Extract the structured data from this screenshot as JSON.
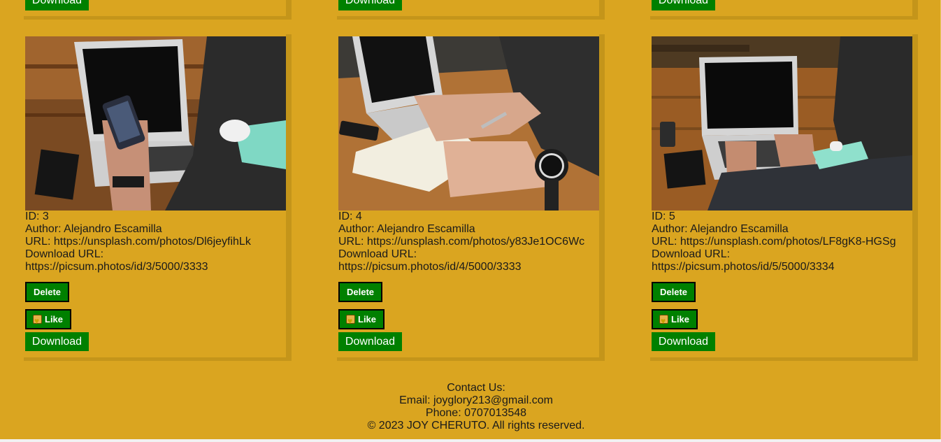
{
  "top_row": {
    "download_labels": [
      "Download",
      "Download",
      "Download"
    ]
  },
  "cards": [
    {
      "id": "ID: 3",
      "author": "Author: Alejandro Escamilla",
      "url": "URL: https://unsplash.com/photos/Dl6jeyfihLk",
      "download_url_label": "Download URL:",
      "download_url": "https://picsum.photos/id/3/5000/3333",
      "delete_label": "Delete",
      "like_label": "Like",
      "download_label": "Download",
      "image_icon": "photo-laptop-phone"
    },
    {
      "id": "ID: 4",
      "author": "Author: Alejandro Escamilla",
      "url": "URL: https://unsplash.com/photos/y83Je1OC6Wc",
      "download_url_label": "Download URL:",
      "download_url": "https://picsum.photos/id/4/5000/3333",
      "delete_label": "Delete",
      "like_label": "Like",
      "download_label": "Download",
      "image_icon": "photo-notebook-watch"
    },
    {
      "id": "ID: 5",
      "author": "Author: Alejandro Escamilla",
      "url": "URL: https://unsplash.com/photos/LF8gK8-HGSg",
      "download_url_label": "Download URL:",
      "download_url": "https://picsum.photos/id/5/5000/3334",
      "delete_label": "Delete",
      "like_label": "Like",
      "download_label": "Download",
      "image_icon": "photo-laptop-typing"
    }
  ],
  "footer": {
    "contact_heading": "Contact Us:",
    "email": "Email: joyglory213@gmail.com",
    "phone": "Phone: 0707013548",
    "copyright": "© 2023 JOY CHERUTO. All rights reserved."
  },
  "colors": {
    "page_background": "#DAA520",
    "button_green": "#008000",
    "card_shadow": "#C4951A"
  }
}
